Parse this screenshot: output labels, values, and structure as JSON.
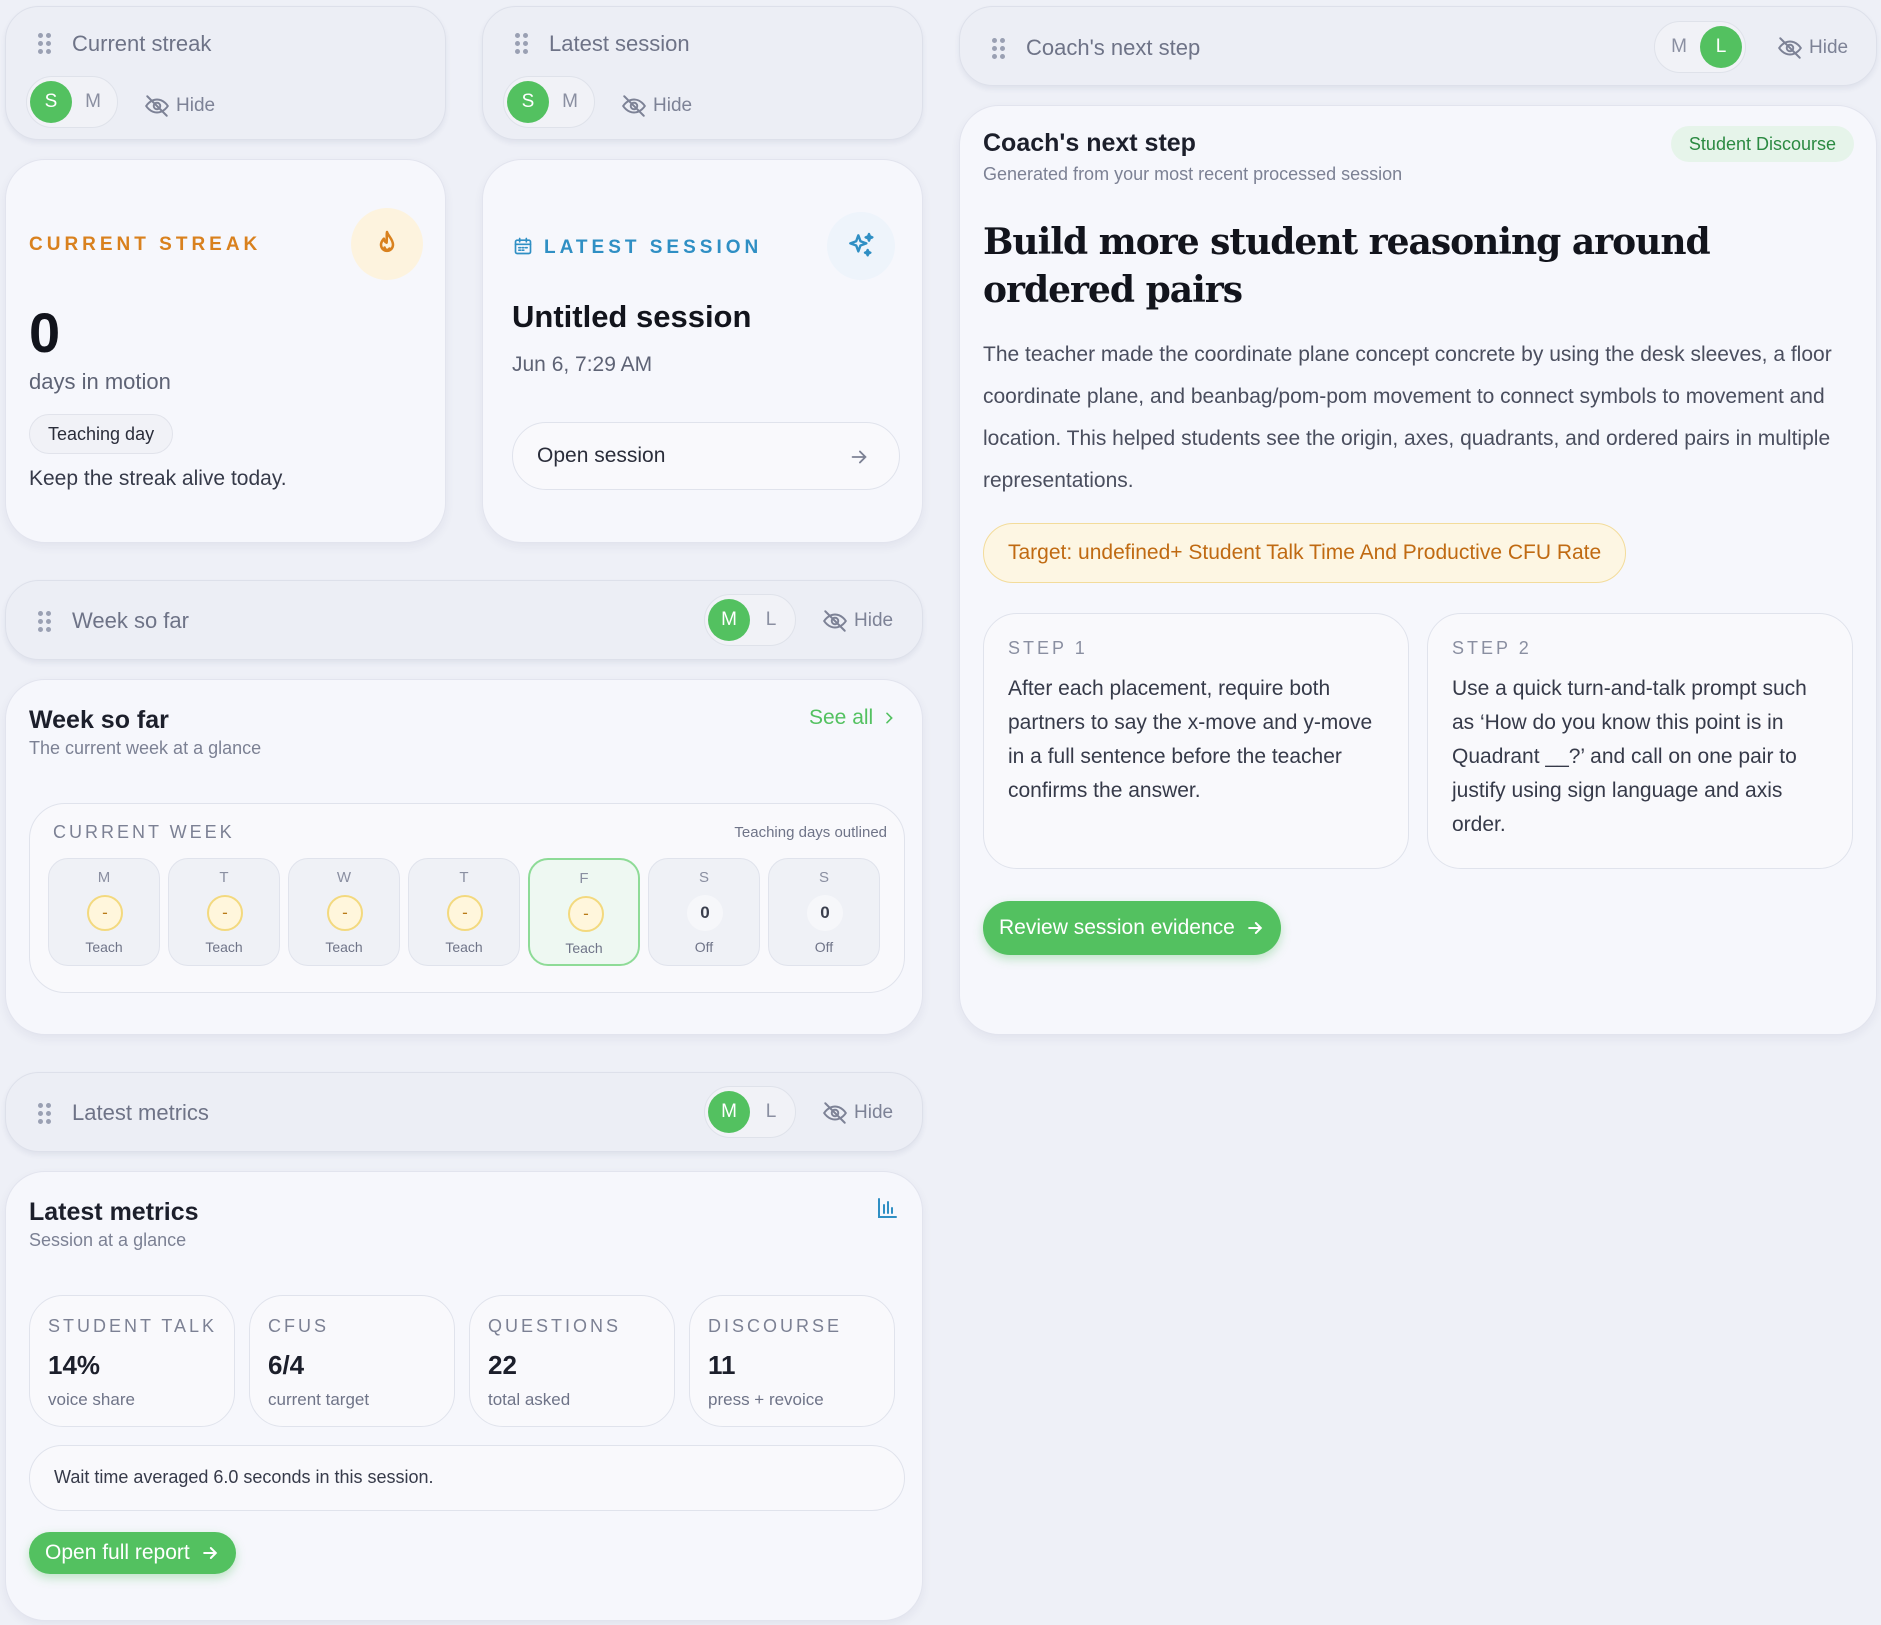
{
  "streak_bar": {
    "title": "Current streak",
    "sizes": [
      "S",
      "M"
    ],
    "hide": "Hide"
  },
  "session_bar": {
    "title": "Latest session",
    "sizes": [
      "S",
      "M"
    ],
    "hide": "Hide"
  },
  "coach_bar": {
    "title": "Coach's next step",
    "sizes": [
      "M",
      "L"
    ],
    "hide": "Hide"
  },
  "week_bar": {
    "title": "Week so far",
    "sizes": [
      "M",
      "L"
    ],
    "hide": "Hide"
  },
  "metrics_bar": {
    "title": "Latest metrics",
    "sizes": [
      "M",
      "L"
    ],
    "hide": "Hide"
  },
  "streak": {
    "eyebrow": "CURRENT STREAK",
    "value": "0",
    "unit": "days in motion",
    "chip": "Teaching day",
    "note": "Keep the streak alive today."
  },
  "session": {
    "eyebrow": "LATEST SESSION",
    "title": "Untitled session",
    "date": "Jun 6, 7:29 AM",
    "open": "Open session"
  },
  "week": {
    "title": "Week so far",
    "subtitle": "The current week at a glance",
    "see_all": "See all",
    "current_label": "CURRENT WEEK",
    "legend": "Teaching days outlined",
    "days": [
      {
        "letter": "M",
        "mark": "-",
        "status": "Teach",
        "type": "teach",
        "today": false
      },
      {
        "letter": "T",
        "mark": "-",
        "status": "Teach",
        "type": "teach",
        "today": false
      },
      {
        "letter": "W",
        "mark": "-",
        "status": "Teach",
        "type": "teach",
        "today": false
      },
      {
        "letter": "T",
        "mark": "-",
        "status": "Teach",
        "type": "teach",
        "today": false
      },
      {
        "letter": "F",
        "mark": "-",
        "status": "Teach",
        "type": "teach",
        "today": true
      },
      {
        "letter": "S",
        "mark": "0",
        "status": "Off",
        "type": "off",
        "today": false
      },
      {
        "letter": "S",
        "mark": "0",
        "status": "Off",
        "type": "off",
        "today": false
      }
    ]
  },
  "metrics": {
    "title": "Latest metrics",
    "subtitle": "Session at a glance",
    "items": [
      {
        "label": "STUDENT TALK",
        "value": "14%",
        "note": "voice share"
      },
      {
        "label": "CFUS",
        "value": "6/4",
        "note": "current target"
      },
      {
        "label": "QUESTIONS",
        "value": "22",
        "note": "total asked"
      },
      {
        "label": "DISCOURSE",
        "value": "11",
        "note": "press + revoice"
      }
    ],
    "wait_note": "Wait time averaged 6.0 seconds in this session.",
    "open_report": "Open full report"
  },
  "coach": {
    "title": "Coach's next step",
    "subtitle": "Generated from your most recent processed session",
    "tag": "Student Discourse",
    "headline": "Build more student reasoning around ordered pairs",
    "body": "The teacher made the coordinate plane concept concrete by using the desk sleeves, a floor coordinate plane, and beanbag/pom-pom movement to connect symbols to movement and location. This helped students see the origin, axes, quadrants, and ordered pairs in multiple representations.",
    "target": "Target: undefined+ Student Talk Time And Productive CFU Rate",
    "steps": [
      {
        "label": "STEP 1",
        "text": "After each placement, require both partners to say the x-move and y-move in a full sentence before the teacher confirms the answer."
      },
      {
        "label": "STEP 2",
        "text": "Use a quick turn-and-talk prompt such as ‘How do you know this point is in Quadrant __?’ and call on one pair to justify using sign language and axis order."
      }
    ],
    "review": "Review session evidence"
  },
  "colors": {
    "accent_green": "#53c160",
    "streak_orange": "#d9811e",
    "session_blue": "#2f8fc4",
    "target_text": "#c06a12"
  }
}
